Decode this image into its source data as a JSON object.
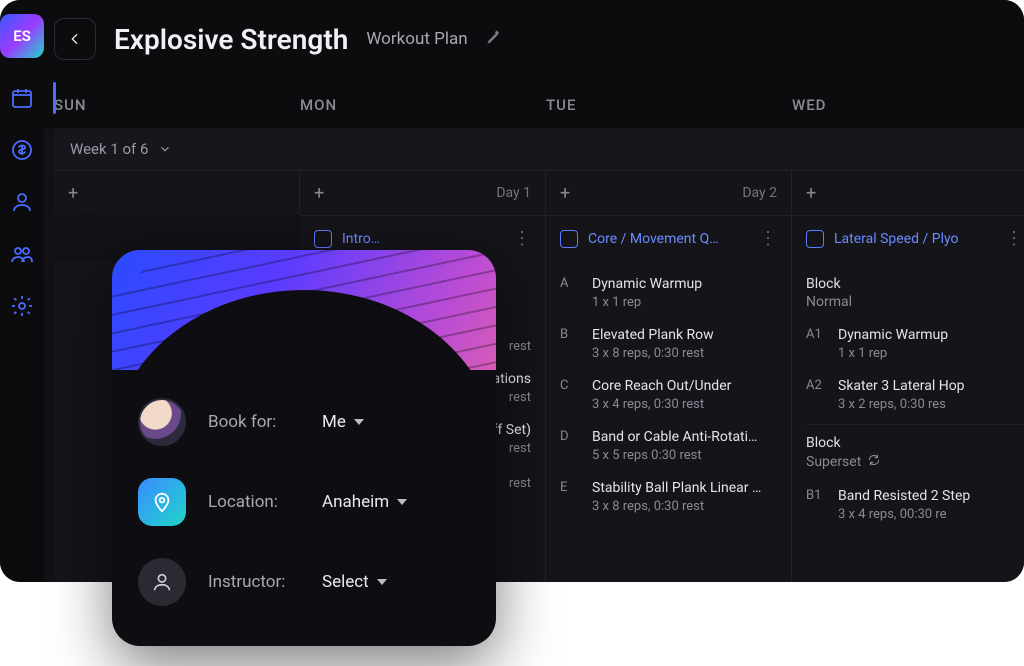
{
  "logo_text": "ES",
  "header": {
    "title": "Explosive Strength",
    "subtitle": "Workout Plan"
  },
  "days": [
    "SUN",
    "MON",
    "TUE",
    "WED"
  ],
  "week_selector": "Week 1 of 6",
  "day_labels": {
    "mon": "Day 1",
    "tue": "Day 2"
  },
  "workout_titles": {
    "mon": "Intro…",
    "tue": "Core / Movement Q…",
    "wed": "Lateral Speed / Plyo"
  },
  "columns": {
    "mon_partial": [
      {
        "sub": "rest"
      },
      {
        "name": "declarations",
        "sub": "rest"
      },
      {
        "name": "k Off Set)",
        "sub": "rest"
      },
      {
        "sub": "rest"
      }
    ],
    "tue": [
      {
        "letter": "A",
        "name": "Dynamic Warmup",
        "sub": "1 x 1 rep"
      },
      {
        "letter": "B",
        "name": "Elevated Plank Row",
        "sub": "3 x 8 reps,  0:30 rest"
      },
      {
        "letter": "C",
        "name": "Core Reach Out/Under",
        "sub": "3 x 4 reps,  0:30 rest"
      },
      {
        "letter": "D",
        "name": "Band or Cable Anti-Rotati…",
        "sub": "5 x 5 reps  0:30 rest"
      },
      {
        "letter": "E",
        "name": "Stability Ball Plank Linear …",
        "sub": "3 x 8 reps,  0:30 rest"
      }
    ],
    "wed": {
      "block1": {
        "label": "Block",
        "sub": "Normal"
      },
      "items1": [
        {
          "letter": "A1",
          "name": "Dynamic Warmup",
          "sub": "1 x 1 rep"
        },
        {
          "letter": "A2",
          "name": "Skater 3 Lateral Hop",
          "sub": "3 x 2 reps,  0:30 res"
        }
      ],
      "block2": {
        "label": "Block",
        "sub": "Superset"
      },
      "items2": [
        {
          "letter": "B1",
          "name": "Band Resisted 2 Step",
          "sub": "3 x 4 reps,  00:30 re"
        }
      ]
    }
  },
  "booking": {
    "book_for_label": "Book for:",
    "book_for_value": "Me",
    "location_label": "Location:",
    "location_value": "Anaheim",
    "instructor_label": "Instructor:",
    "instructor_value": "Select"
  }
}
